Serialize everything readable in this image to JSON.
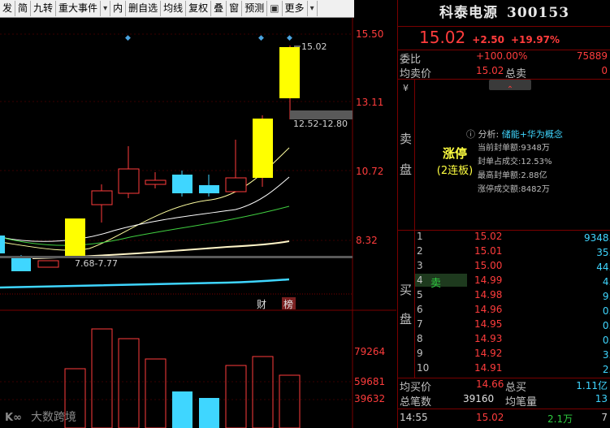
{
  "toolbar": {
    "items": [
      "发",
      "简",
      "九转",
      "重大事件",
      "内",
      "删自选",
      "均线",
      "复权",
      "叠",
      "窗",
      "预测",
      "更多"
    ],
    "arrow": "▾"
  },
  "chart": {
    "price_axis": [
      "15.50",
      "13.11",
      "10.72",
      "8.32"
    ],
    "vol_axis": [
      "79264",
      "59681",
      "39632"
    ],
    "high_label": "15.02",
    "range_label_top": "12.52-12.80",
    "range_label_bottom": "7.68-7.77",
    "tag_cai": "财",
    "tag_bang": "榜",
    "watermark": "大数跨境"
  },
  "quote": {
    "name": "科泰电源",
    "code": "300153",
    "price": "15.02",
    "change": "+2.50",
    "pct": "+19.97%",
    "weibi_label": "委比",
    "weibi_pct": "+100.00%",
    "weibi_num": "75889",
    "jmj_label": "均卖价",
    "jmj_val": "15.02",
    "zongmai_label": "总卖",
    "zongmai_val": "0",
    "yen": "¥",
    "mai_label1": "卖",
    "mai_label2": "盘",
    "zt_title": "涨停",
    "zt_sub": "(2连板)",
    "analysis_prefix": "分析:",
    "analysis_text": "储能+华为概念",
    "fd_amount": "当前封单额:9348万",
    "fd_ratio": "封单占成交:12.53%",
    "fd_max": "最高封单额:2.88亿",
    "zt_turnover": "涨停成交额:8482万",
    "mai_label3": "买",
    "mai_label4": "盘",
    "buy_hint": "卖",
    "bids": [
      {
        "lv": "1",
        "p": "15.02",
        "v": "9348.2万"
      },
      {
        "lv": "2",
        "p": "15.01",
        "v": "35.9万"
      },
      {
        "lv": "3",
        "p": "15.00",
        "v": "44.6万"
      },
      {
        "lv": "4",
        "p": "14.99",
        "v": "4.0万"
      },
      {
        "lv": "5",
        "p": "14.98",
        "v": "9.7万"
      },
      {
        "lv": "6",
        "p": "14.96",
        "v": "0.3万"
      },
      {
        "lv": "7",
        "p": "14.95",
        "v": "0.7万"
      },
      {
        "lv": "8",
        "p": "14.93",
        "v": "0.7万"
      },
      {
        "lv": "9",
        "p": "14.92",
        "v": "3.6万"
      },
      {
        "lv": "10",
        "p": "14.91",
        "v": "2.5万"
      }
    ],
    "jmjb_label": "均买价",
    "jmjb_val": "14.66",
    "zongmai2_label": "总买",
    "zongmai2_val": "1.11亿",
    "zbs_label": "总笔数",
    "zbs_val": "39160",
    "jbl_label": "均笔量",
    "jbl_val": "13",
    "tick_time": "14:55",
    "tick_price": "15.02",
    "tick_vol": "2.1万",
    "tick_num": "7"
  },
  "colors": {
    "up": "#ff3c3c",
    "down": "#3fd6ff",
    "bg": "#000000",
    "grid": "#7a0000"
  }
}
